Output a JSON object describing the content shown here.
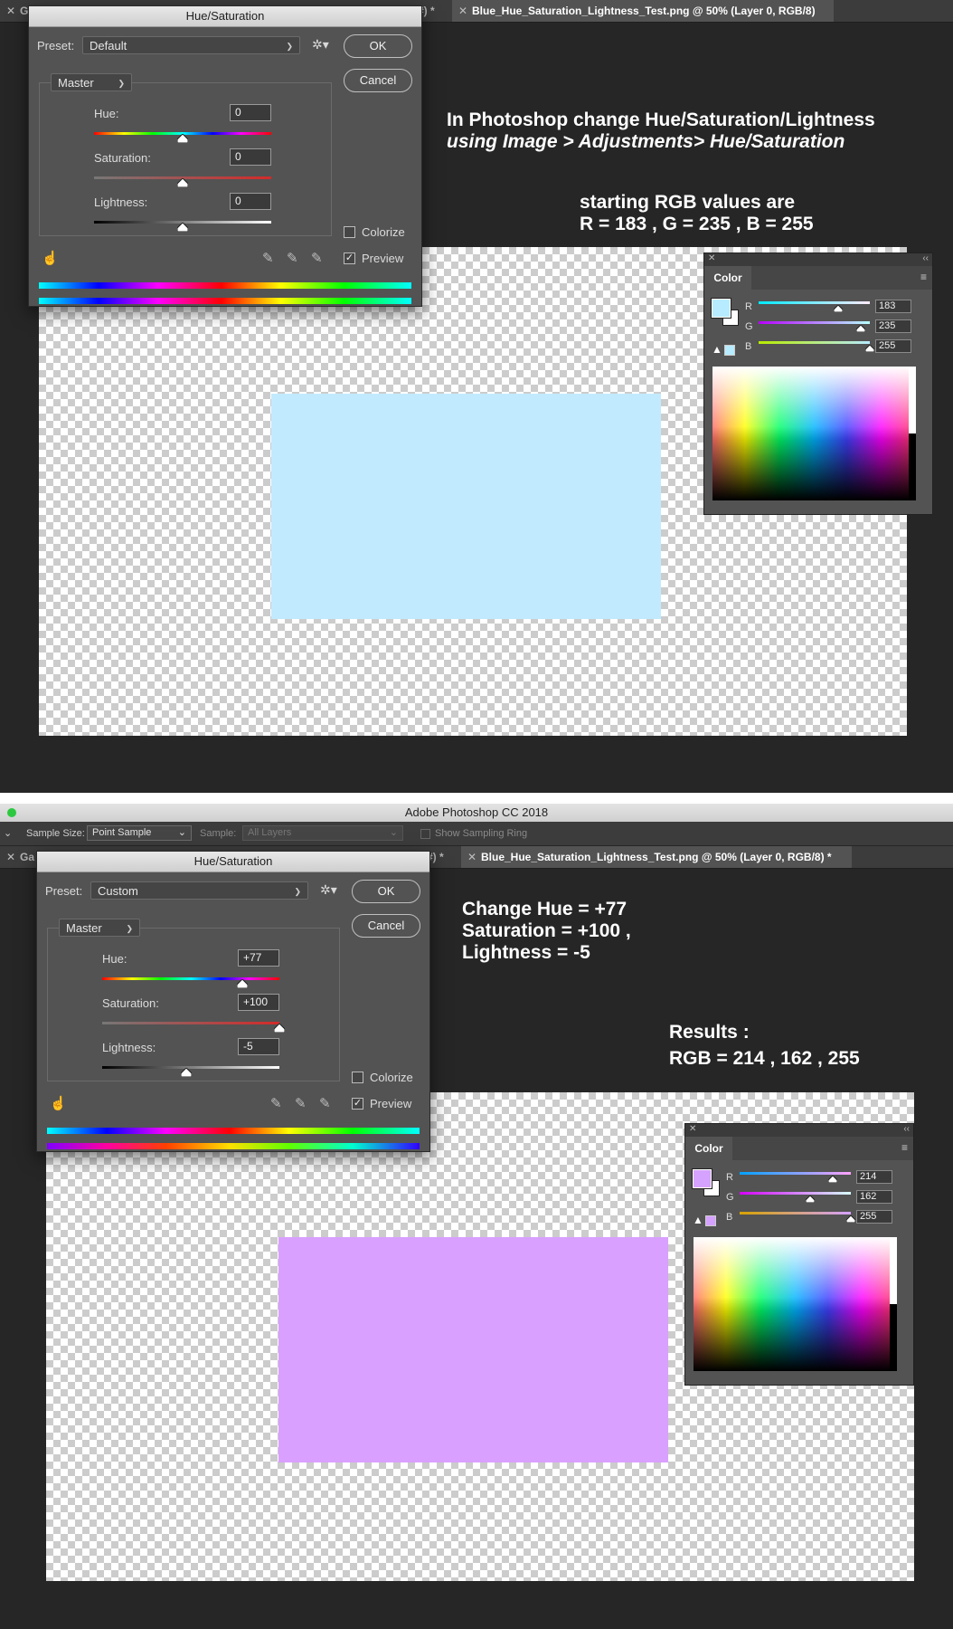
{
  "screens": [
    {
      "tabs": [
        "Ga",
        "#) *",
        "Blue_Hue_Saturation_Lightness_Test.png @ 50% (Layer 0, RGB/8)"
      ],
      "annotations": [
        [
          "In Photoshop change Hue/Saturation/Lightness",
          "using Image > Adjustments> Hue/Saturation"
        ],
        [
          "starting RGB values are",
          "R = 183 , G = 235 , B = 255"
        ]
      ],
      "dialog": {
        "title": "Hue/Saturation",
        "preset_label": "Preset:",
        "preset_value": "Default",
        "channel": "Master",
        "hue_label": "Hue:",
        "hue_value": "0",
        "saturation_label": "Saturation:",
        "saturation_value": "0",
        "lightness_label": "Lightness:",
        "lightness_value": "0",
        "hue_slider_fraction": 0.5,
        "saturation_slider_fraction": 0.5,
        "lightness_slider_fraction": 0.5,
        "ok_label": "OK",
        "cancel_label": "Cancel",
        "colorize_label": "Colorize",
        "colorize_checked": false,
        "preview_label": "Preview",
        "preview_checked": true,
        "icons": [
          "gear-icon",
          "hand-target-icon",
          "eyedropper-icon",
          "eyedropper-plus-icon",
          "eyedropper-minus-icon"
        ]
      },
      "color_panel": {
        "tab": "Color",
        "r_label": "R",
        "g_label": "G",
        "b_label": "B",
        "r_value": "183",
        "g_value": "235",
        "b_value": "255",
        "swatch": "#b7ebff"
      },
      "rect_color": "#c2eaff"
    },
    {
      "app_title": "Adobe Photoshop CC 2018",
      "options_bar": {
        "sample_size_label": "Sample Size:",
        "sample_size_value": "Point Sample",
        "sample_label": "Sample:",
        "sample_value": "All Layers",
        "sampling_ring_label": "Show Sampling Ring"
      },
      "tabs": [
        "Ga",
        "#) *",
        "Blue_Hue_Saturation_Lightness_Test.png @ 50% (Layer 0, RGB/8) *"
      ],
      "annotations": [
        [
          "Change Hue =  +77",
          "Saturation = +100 ,",
          "Lightness =  -5"
        ],
        [
          "Results :",
          "RGB = 214 , 162 , 255"
        ]
      ],
      "dialog": {
        "title": "Hue/Saturation",
        "preset_label": "Preset:",
        "preset_value": "Custom",
        "channel": "Master",
        "hue_label": "Hue:",
        "hue_value": "+77",
        "saturation_label": "Saturation:",
        "saturation_value": "+100",
        "lightness_label": "Lightness:",
        "lightness_value": "-5",
        "hue_slider_fraction": 0.79,
        "saturation_slider_fraction": 1.0,
        "lightness_slider_fraction": 0.475,
        "ok_label": "OK",
        "cancel_label": "Cancel",
        "colorize_label": "Colorize",
        "colorize_checked": false,
        "preview_label": "Preview",
        "preview_checked": true,
        "icons": [
          "gear-icon",
          "hand-target-icon",
          "eyedropper-icon",
          "eyedropper-plus-icon",
          "eyedropper-minus-icon"
        ]
      },
      "color_panel": {
        "tab": "Color",
        "r_label": "R",
        "g_label": "G",
        "b_label": "B",
        "r_value": "214",
        "g_value": "162",
        "b_value": "255",
        "swatch": "#d6a2ff"
      },
      "rect_color": "#d9a0ff"
    }
  ]
}
